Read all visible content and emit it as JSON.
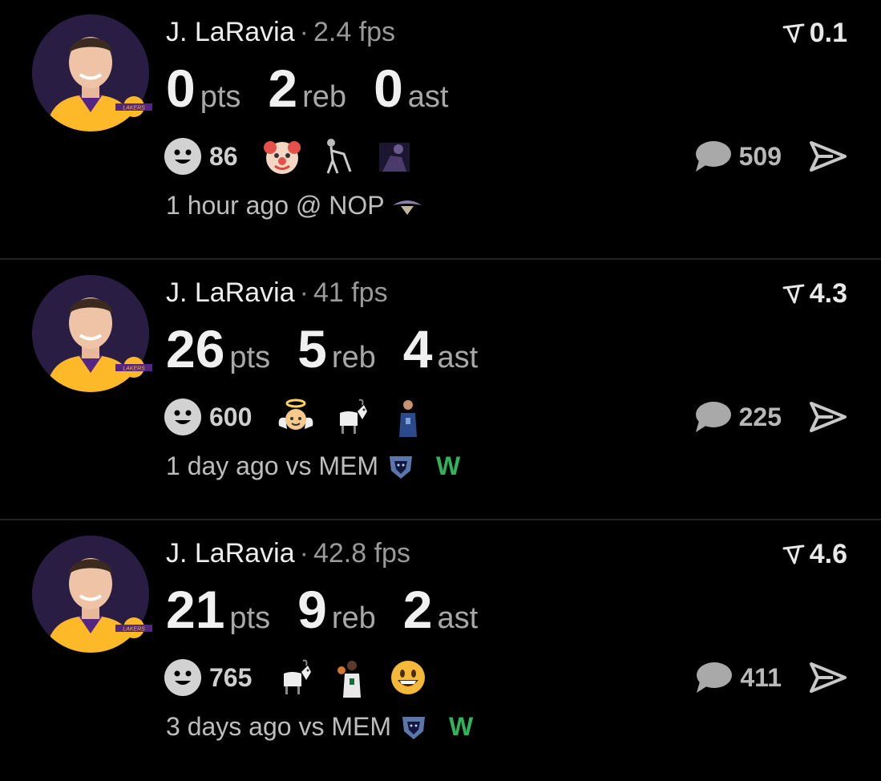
{
  "cards": [
    {
      "player": "J. LaRavia",
      "separator": "·",
      "fps": "2.4 fps",
      "rating": "0.1",
      "stats": [
        {
          "value": "0",
          "unit": "pts"
        },
        {
          "value": "2",
          "unit": "reb"
        },
        {
          "value": "0",
          "unit": "ast"
        }
      ],
      "reaction_count": "86",
      "reactions": [
        "clown-emoji",
        "skeleton-cane-emoji",
        "dark-figure-emoji"
      ],
      "comment_count": "509",
      "time_text": "1 hour ago @ NOP",
      "opponent_logo": "pelicans-logo",
      "result": ""
    },
    {
      "player": "J. LaRavia",
      "separator": "·",
      "fps": "41 fps",
      "rating": "4.3",
      "stats": [
        {
          "value": "26",
          "unit": "pts"
        },
        {
          "value": "5",
          "unit": "reb"
        },
        {
          "value": "4",
          "unit": "ast"
        }
      ],
      "reaction_count": "600",
      "reactions": [
        "angel-emoji",
        "goat-emoji",
        "player-photo-emoji"
      ],
      "comment_count": "225",
      "time_text": "1 day ago vs MEM",
      "opponent_logo": "grizzlies-logo",
      "result": "W"
    },
    {
      "player": "J. LaRavia",
      "separator": "·",
      "fps": "42.8 fps",
      "rating": "4.6",
      "stats": [
        {
          "value": "21",
          "unit": "pts"
        },
        {
          "value": "9",
          "unit": "reb"
        },
        {
          "value": "2",
          "unit": "ast"
        }
      ],
      "reaction_count": "765",
      "reactions": [
        "goat-emoji",
        "player-photo-emoji",
        "grinning-face-emoji"
      ],
      "comment_count": "411",
      "time_text": "3 days ago vs MEM",
      "opponent_logo": "grizzlies-logo",
      "result": "W"
    }
  ],
  "colors": {
    "background": "#000000",
    "win": "#31b35a",
    "lakers_purple": "#552583",
    "lakers_gold": "#fdb927"
  }
}
